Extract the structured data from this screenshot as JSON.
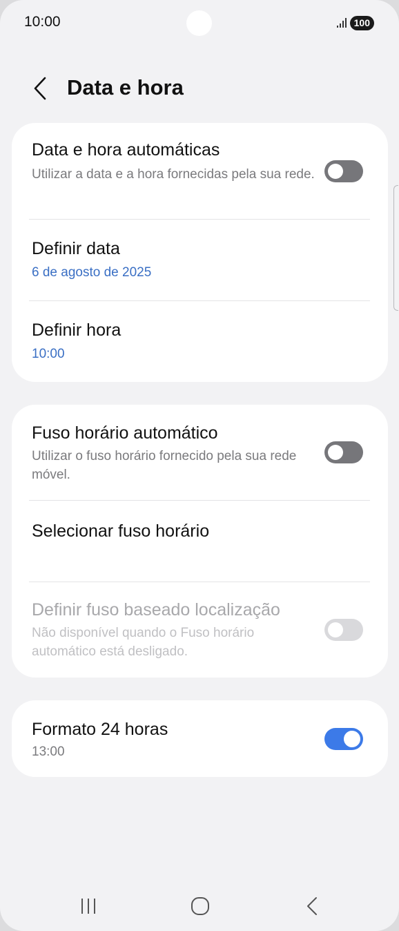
{
  "status_bar": {
    "time": "10:00",
    "battery": "100",
    "signal_icon": "signal-icon"
  },
  "header": {
    "title": "Data e hora",
    "back_icon": "chevron-left-icon"
  },
  "card1": {
    "auto_datetime": {
      "title": "Data e hora automáticas",
      "subtitle": "Utilizar a data e a hora fornecidas pela sua rede.",
      "enabled": false
    },
    "set_date": {
      "title": "Definir data",
      "value": "6 de agosto de 2025"
    },
    "set_time": {
      "title": "Definir hora",
      "value": "10:00"
    }
  },
  "card2": {
    "auto_timezone": {
      "title": "Fuso horário automático",
      "subtitle": "Utilizar o fuso horário fornecido pela sua rede móvel.",
      "enabled": false
    },
    "select_timezone": {
      "title": "Selecionar fuso horário"
    },
    "location_timezone": {
      "title": "Definir fuso baseado localização",
      "subtitle": "Não disponível quando o Fuso horário automático está desligado.",
      "enabled": false,
      "disabled": true
    }
  },
  "card3": {
    "format_24h": {
      "title": "Formato 24 horas",
      "value": "13:00",
      "enabled": true
    }
  },
  "colors": {
    "background": "#f2f2f4",
    "card": "#ffffff",
    "accent": "#3a6fc4",
    "toggle_on": "#3c7ae8",
    "toggle_off": "#76767a"
  },
  "navbar": {
    "recents_icon": "recents-icon",
    "home_icon": "home-icon",
    "back_icon": "back-icon"
  }
}
